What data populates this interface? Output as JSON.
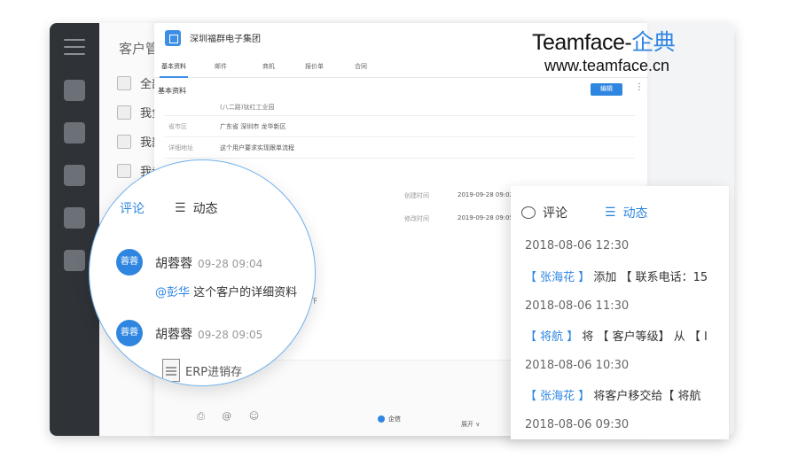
{
  "brand": {
    "name": "Teamface-",
    "name_cn": "企典",
    "url": "www.teamface.cn"
  },
  "list_panel": {
    "title": "客户管",
    "rows": [
      "全部",
      "我负",
      "我部",
      "我参"
    ]
  },
  "detail": {
    "company_name": "深圳福群电子集团",
    "tabs": [
      "基本资料",
      "邮件",
      "商机",
      "报价单",
      "合同"
    ],
    "section_title": "基本资料",
    "edit_label": "编辑",
    "more_label": "⋮",
    "partial_top": "(八二路)钛红工业园",
    "fields": [
      {
        "label": "省市区",
        "value": "广东省 深圳市 龙华新区"
      },
      {
        "label": "详细地址",
        "value": "这个用户要求实现跟单流程"
      }
    ],
    "meta": [
      {
        "label": "创建时间",
        "value": "2019-09-28 09:02"
      },
      {
        "label": "修改时间",
        "value": "2019-09-28 09:05"
      }
    ],
    "faint_comment": "看下",
    "composer": {
      "icons": "⎙ @ ☺",
      "dropdown": "企信",
      "expand": "展开 ∨"
    }
  },
  "zoom_comments": {
    "tab_comment": "评论",
    "tab_activity": "动态",
    "entries": [
      {
        "avatar": "蓉蓉",
        "author": "胡蓉蓉",
        "time": "09-28 09:04",
        "mention": "@彭华",
        "text": " 这个客户的详细资料"
      },
      {
        "avatar": "蓉蓉",
        "author": "胡蓉蓉",
        "time": "09-28 09:05",
        "file": "ERP进销存"
      }
    ]
  },
  "activity_panel": {
    "tab_comment": "评论",
    "tab_activity": "动态",
    "entries": [
      {
        "time": "2018-08-06 12:30",
        "who": "【 张海花 】",
        "desc": " 添加 【 联系电话：15"
      },
      {
        "time": "2018-08-06 11:30",
        "who": "【 将航 】",
        "desc": " 将 【 客户等级】 从 【 I"
      },
      {
        "time": "2018-08-06 10:30",
        "who": "【 张海花 】",
        "desc": " 将客户移交给【 将航"
      },
      {
        "time": "2018-08-06 09:30",
        "who": "",
        "desc": ""
      }
    ]
  }
}
